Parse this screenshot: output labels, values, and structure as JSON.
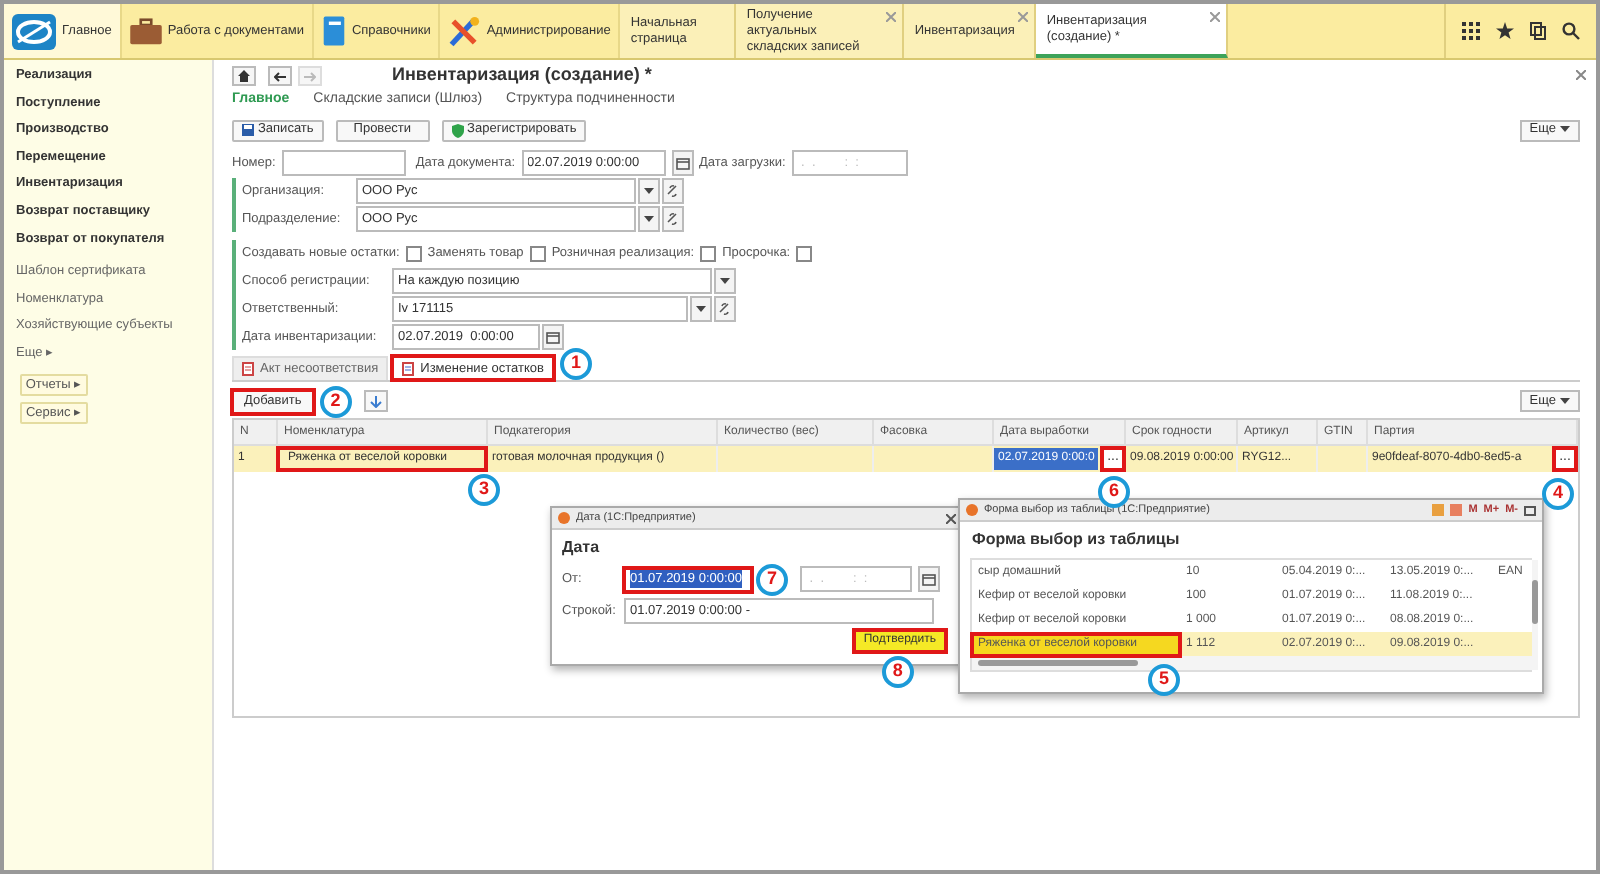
{
  "top_bar": {
    "sections": [
      {
        "label": "Главное",
        "kind": "logo"
      },
      {
        "label": "Работа с документами",
        "kind": "briefcase"
      },
      {
        "label": "Справочники",
        "kind": "book"
      },
      {
        "label": "Администрирование",
        "kind": "tools"
      }
    ],
    "open_tabs": [
      {
        "label": "Начальная страница",
        "closable": false,
        "selected": false
      },
      {
        "label": "Получение актуальных складских записей",
        "closable": true,
        "selected": false
      },
      {
        "label": "Инвентаризация",
        "closable": true,
        "selected": false
      },
      {
        "label": "Инвентаризация (создание) *",
        "closable": true,
        "selected": true
      }
    ]
  },
  "sidebar": {
    "items": [
      {
        "label": "Реализация",
        "kind": "section"
      },
      {
        "label": "Поступление",
        "kind": "section"
      },
      {
        "label": "Производство",
        "kind": "section"
      },
      {
        "label": "Перемещение",
        "kind": "section"
      },
      {
        "label": "Инвентаризация",
        "kind": "section"
      },
      {
        "label": "Возврат поставщику",
        "kind": "section"
      },
      {
        "label": "Возврат от покупателя",
        "kind": "section"
      },
      {
        "label": "Шаблон сертификата",
        "kind": "link"
      },
      {
        "label": "Номенклатура",
        "kind": "link"
      },
      {
        "label": "Хозяйствующие субъекты",
        "kind": "link"
      },
      {
        "label": "Еще ▸",
        "kind": "link"
      }
    ],
    "buttons": [
      "Отчеты ▸",
      "Сервис ▸"
    ]
  },
  "form": {
    "title": "Инвентаризация (создание) *",
    "nav_links": [
      {
        "label": "Главное",
        "selected": true
      },
      {
        "label": "Складские записи (Шлюз)",
        "selected": false
      },
      {
        "label": "Структура подчиненности",
        "selected": false
      }
    ],
    "commands": [
      {
        "label": "Записать",
        "kind": "save"
      },
      {
        "label": "Провести",
        "kind": "plain"
      },
      {
        "label": "Зарегистрировать",
        "kind": "register"
      }
    ],
    "more_label": "Еще",
    "number": {
      "label": "Номер:"
    },
    "doc_date": {
      "label": "Дата документа:",
      "value": "02.07.2019 0:00:00"
    },
    "load_date": {
      "label": "Дата загрузки:",
      "placeholder": " .  .        :  :"
    },
    "organization": {
      "label": "Организация:",
      "value": "ООО Рус"
    },
    "division": {
      "label": "Подразделение:",
      "value": "ООО Рус"
    },
    "flags": [
      {
        "label": "Создавать новые остатки:",
        "checked": false
      },
      {
        "label": "Заменять товар",
        "checked": false
      },
      {
        "label": "Розничная реализация:",
        "checked": false
      },
      {
        "label": "Просрочка:",
        "checked": false
      }
    ],
    "registration": {
      "label": "Способ регистрации:",
      "value": "На каждую позицию"
    },
    "responsible": {
      "label": "Ответственный:",
      "value": "Iv 171115"
    },
    "inventory_date": {
      "label": "Дата инвентаризации:",
      "value": "02.07.2019  0:00:00"
    },
    "tabs": [
      {
        "label": "Акт несоответствия",
        "selected": false,
        "highlighted": false
      },
      {
        "label": "Изменение остатков",
        "selected": true,
        "highlighted": true
      }
    ],
    "add_button": {
      "label": "Добавить",
      "highlighted": true
    },
    "table_more_label": "Еще",
    "table": {
      "columns": [
        "N",
        "Номенклатура",
        "Подкатегория",
        "Количество (вес)",
        "Фасовка",
        "Дата выработки",
        "Срок годности",
        "Артикул",
        "GTIN",
        "Партия"
      ],
      "rows": [
        {
          "selected": true,
          "cells": [
            {
              "text": "1"
            },
            {
              "text": "Ряженка от веселой коровки",
              "highlighted": true
            },
            {
              "text": "готовая молочная продукция ()"
            },
            {},
            {},
            {
              "text": "02.07.2019 0:00:0",
              "text_selected": true,
              "choice_button": {
                "label": "...",
                "highlighted": true
              }
            },
            {
              "text": "09.08.2019 0:00:00"
            },
            {
              "text": "RYG12..."
            },
            {},
            {
              "text": "9e0fdeaf-8070-4db0-8ed5-a",
              "choice_button": {
                "label": "...",
                "highlighted": true
              }
            }
          ]
        }
      ]
    }
  },
  "date_dialog": {
    "window_title": "Дата  (1С:Предприятие)",
    "heading": "Дата",
    "from": {
      "label": "От:",
      "value": "01.07.2019  0:00:00",
      "text_selected": true,
      "highlighted": true
    },
    "to": {
      "placeholder": " .  .        :  :"
    },
    "as_text": {
      "label": "Строкой:",
      "value": "01.07.2019 0:00:00 -"
    },
    "confirm": {
      "label": "Подтвердить",
      "highlighted": true
    }
  },
  "table_dialog": {
    "window_title": "Форма выбор из таблицы  (1С:Предприятие)",
    "memory_buttons": [
      "M",
      "M+",
      "M-"
    ],
    "heading": "Форма выбор из таблицы",
    "rows": [
      {
        "selected": false,
        "cells": [
          {
            "text": "сыр домашний"
          },
          {
            "text": "10"
          },
          {
            "text": "05.04.2019 0:..."
          },
          {
            "text": "13.05.2019 0:..."
          },
          {
            "text": "EAN"
          }
        ]
      },
      {
        "selected": false,
        "cells": [
          {
            "text": "Кефир от веселой коровки"
          },
          {
            "text": "100"
          },
          {
            "text": "01.07.2019 0:..."
          },
          {
            "text": "11.08.2019 0:..."
          },
          {}
        ]
      },
      {
        "selected": false,
        "cells": [
          {
            "text": "Кефир от веселой коровки"
          },
          {
            "text": "1 000"
          },
          {
            "text": "01.07.2019 0:..."
          },
          {
            "text": "08.08.2019 0:..."
          },
          {}
        ]
      },
      {
        "selected": true,
        "cells": [
          {
            "text": "Ряженка от веселой коровки",
            "highlighted": true
          },
          {
            "text": "1 112"
          },
          {
            "text": "02.07.2019 0:..."
          },
          {
            "text": "09.08.2019 0:..."
          },
          {}
        ]
      }
    ]
  },
  "callouts": [
    {
      "number": "1"
    },
    {
      "number": "2"
    },
    {
      "number": "3"
    },
    {
      "number": "4"
    },
    {
      "number": "5"
    },
    {
      "number": "6"
    },
    {
      "number": "7"
    },
    {
      "number": "8"
    }
  ]
}
